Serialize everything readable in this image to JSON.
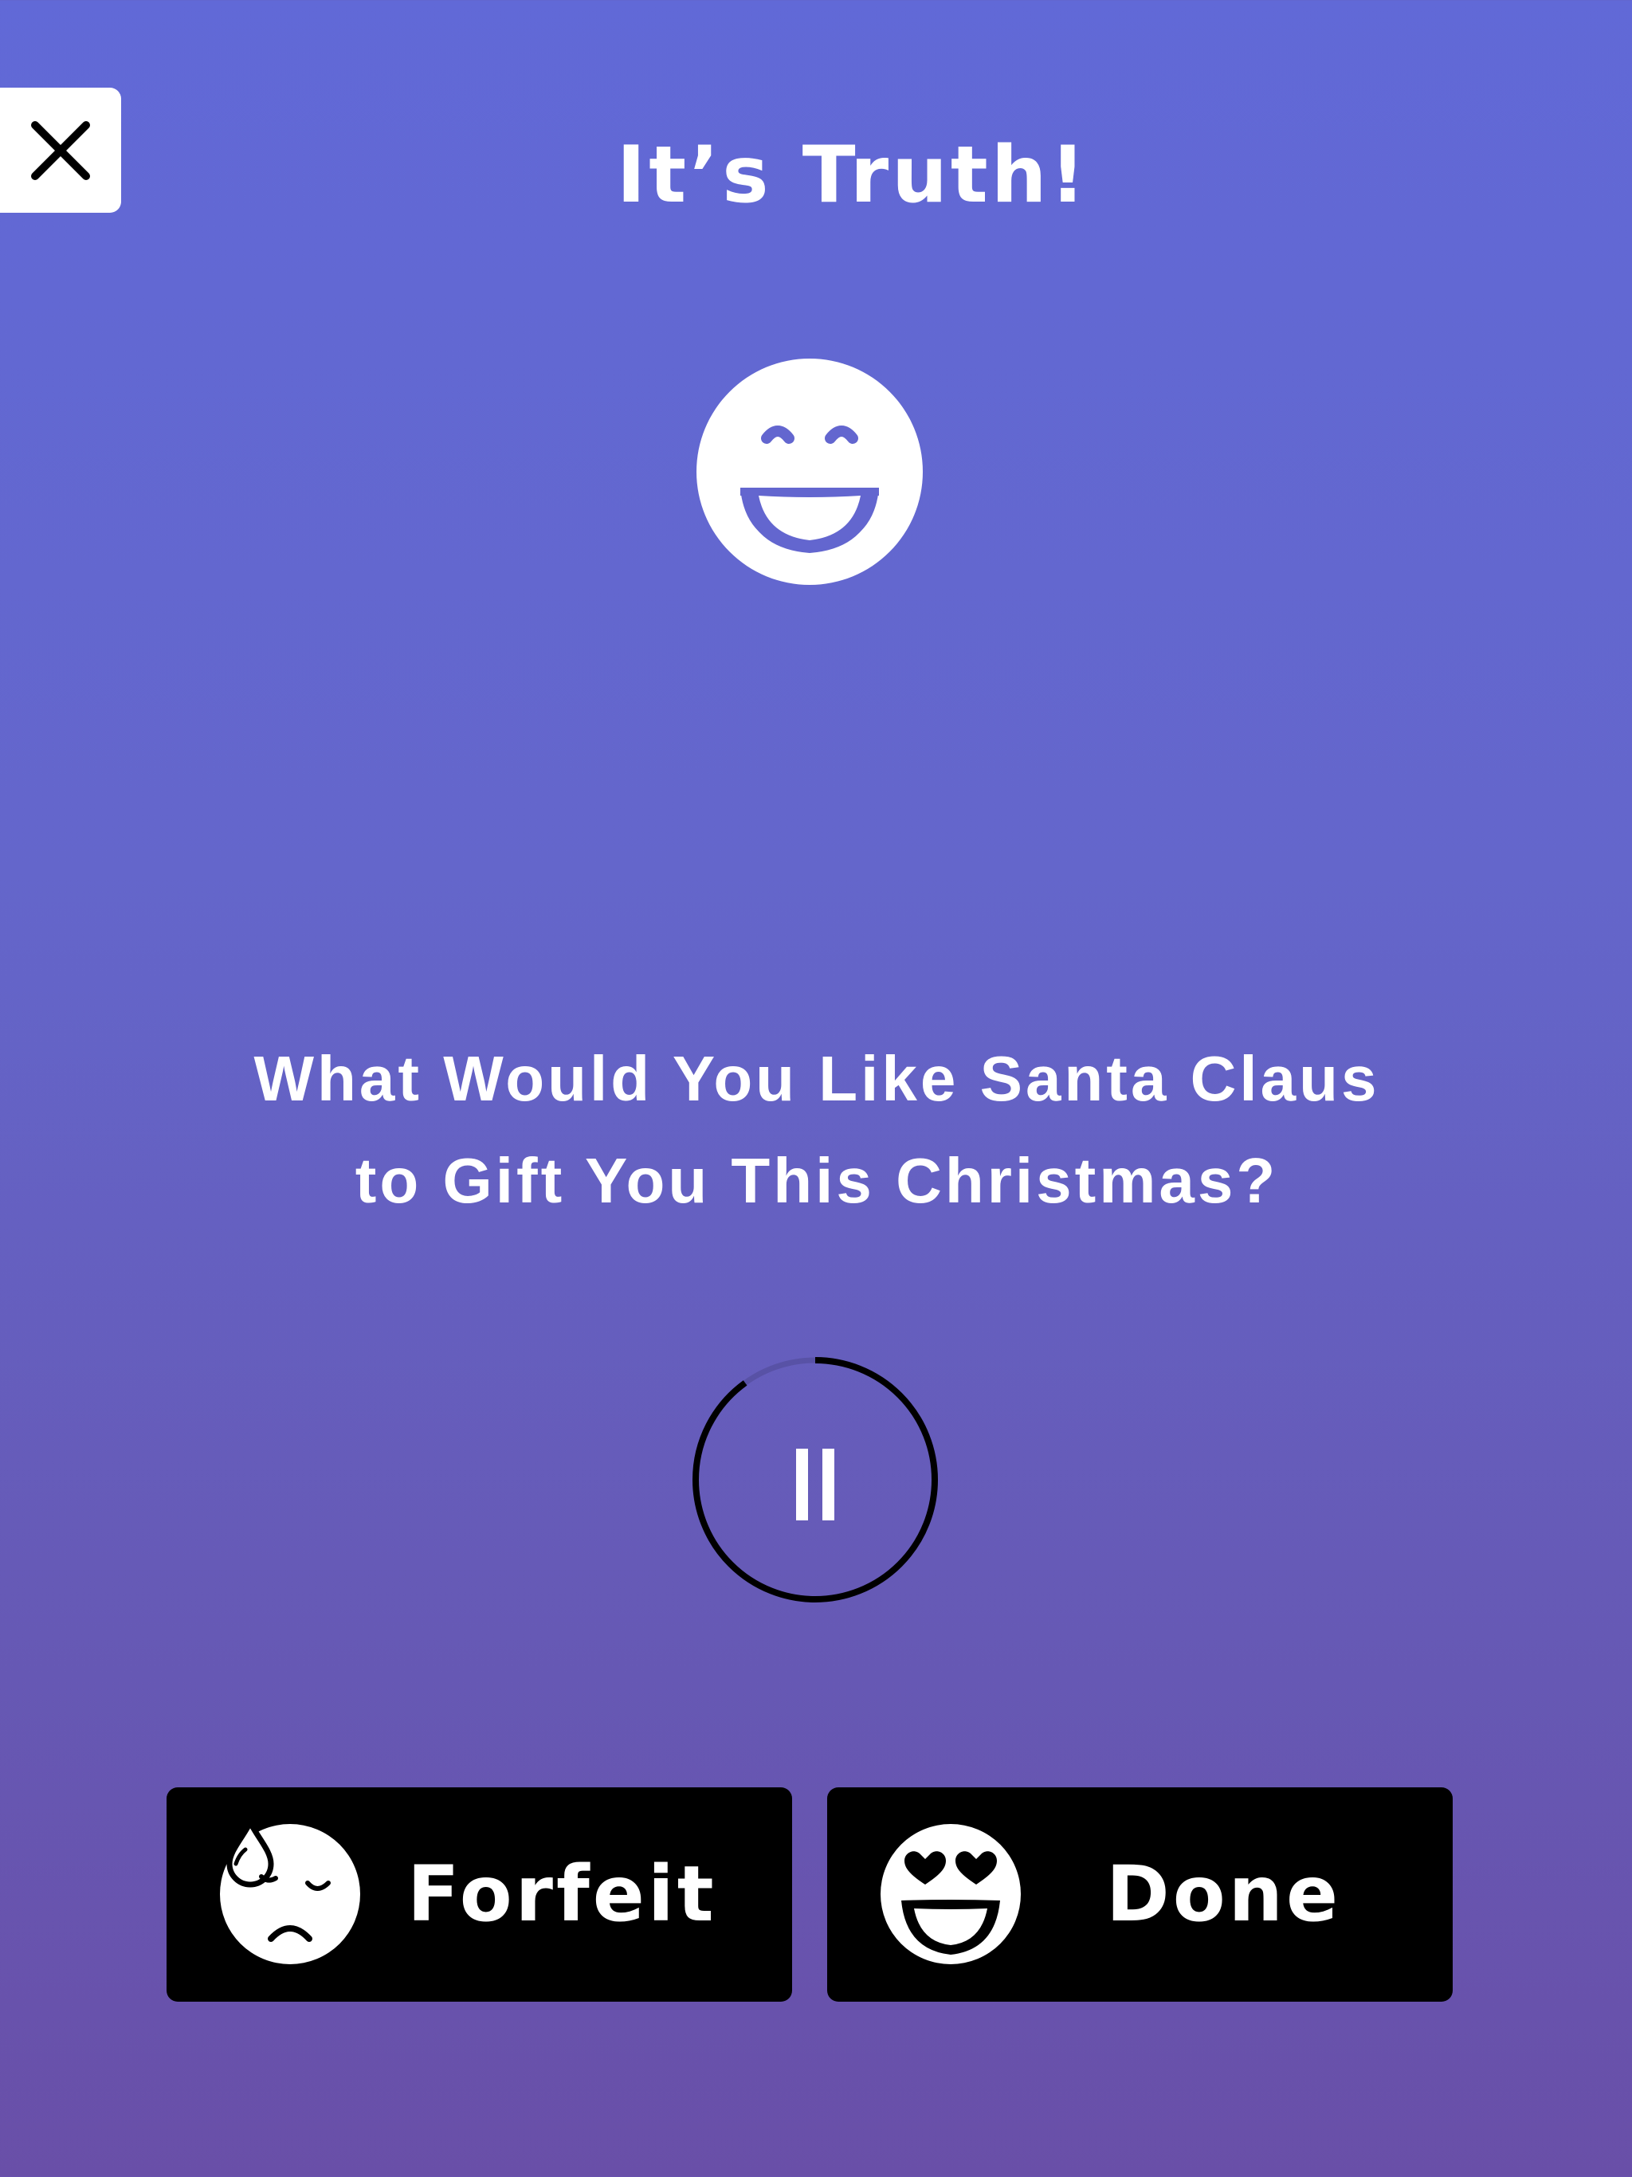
{
  "header": {
    "title": "It’s Truth!"
  },
  "icons": {
    "close": "close-icon",
    "hero": "grinning-face-icon",
    "timer": "pause-icon",
    "forfeit": "sweat-sad-face-icon",
    "done": "heart-eyes-face-icon"
  },
  "card": {
    "question_line1": "What Would You Like Santa Claus",
    "question_line2": "to Gift You This Christmas?"
  },
  "timer": {
    "progress": 0.9,
    "state": "running"
  },
  "actions": {
    "forfeit_label": "Forfeit",
    "done_label": "Done"
  },
  "colors": {
    "background_top": "#6169d7",
    "background_bottom": "#694fa8",
    "button_bg": "#000000",
    "text": "#ffffff"
  }
}
